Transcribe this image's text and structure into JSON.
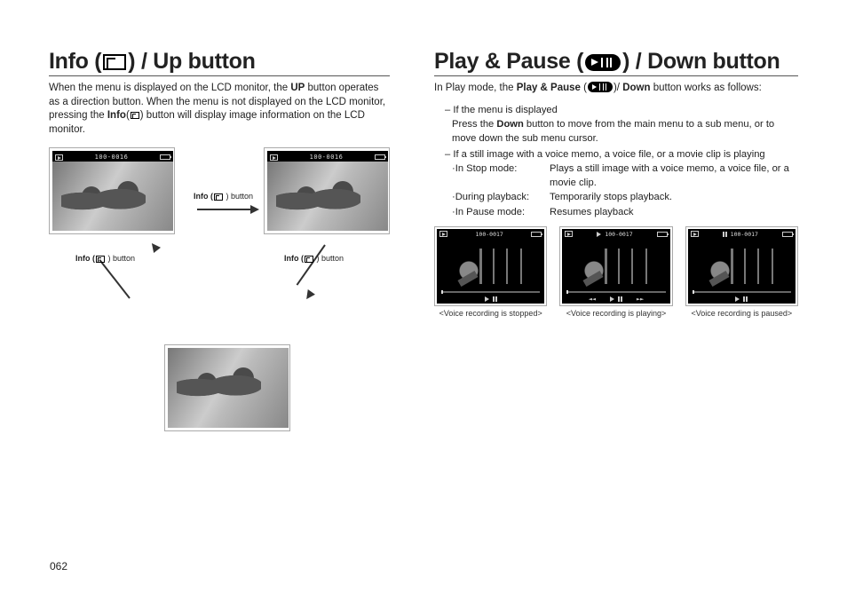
{
  "page_number": "062",
  "left": {
    "heading_pre": "Info (",
    "heading_post": ") / Up button",
    "intro_parts": [
      "When the menu is displayed on the LCD monitor, the ",
      "UP",
      " button operates as a direction button. When the menu is not displayed on the LCD monitor, pressing the ",
      "Info",
      "(",
      ") button will display image information on the LCD monitor."
    ],
    "caption_label_pre": "Info (",
    "caption_label_post": " ) button",
    "osd_file": "100-0016"
  },
  "right": {
    "heading_pre": "Play & Pause (",
    "heading_post": ") / Down button",
    "intro_pre": "In Play mode, the ",
    "intro_bold1": "Play & Pause",
    "intro_mid1": " (",
    "intro_mid2": ")/ ",
    "intro_bold2": "Down",
    "intro_post": " button works as follows:",
    "bullet1_a": "If the menu is displayed",
    "bullet1_b_pre": "Press the ",
    "bullet1_b_bold": "Down",
    "bullet1_b_post": " button to move from the main menu to a sub menu, or to move down the sub menu cursor.",
    "bullet2": "If a still image with a voice memo, a voice file, or a movie clip is playing",
    "modes": [
      {
        "label": "·In Stop mode:",
        "desc": "Plays a still image with a voice memo, a voice file, or a movie clip."
      },
      {
        "label": "·During playback:",
        "desc": "Temporarily stops playback."
      },
      {
        "label": "·In Pause mode:",
        "desc": "Resumes playback"
      }
    ],
    "osd_file": "100-0017",
    "thumb_captions": [
      "<Voice recording is stopped>",
      "<Voice recording is playing>",
      "<Voice recording is paused>"
    ]
  }
}
